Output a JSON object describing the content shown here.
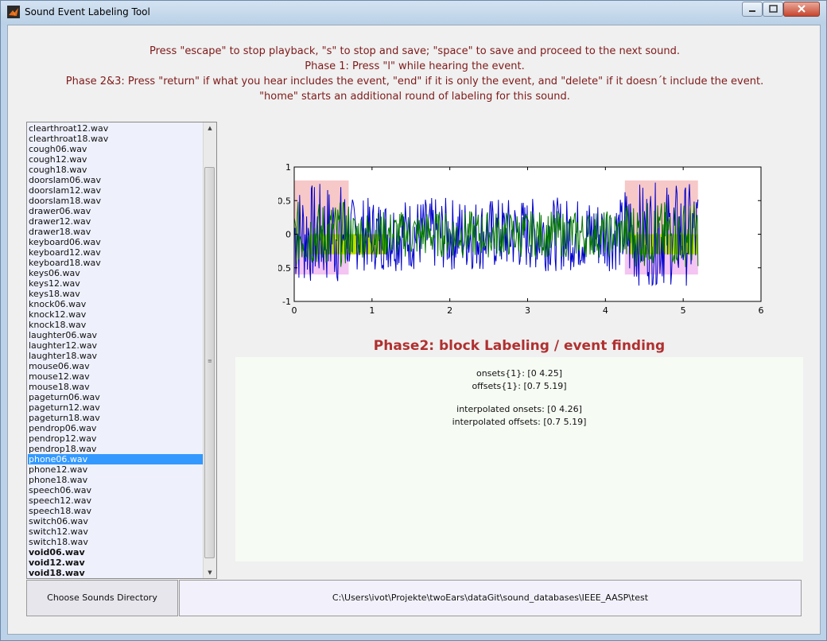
{
  "window": {
    "title": "Sound Event Labeling Tool",
    "buttons": {
      "minimize": "minimize",
      "maximize": "maximize",
      "close": "close"
    }
  },
  "instructions": [
    "Press \"escape\" to stop playback, \"s\" to stop and save; \"space\" to save and proceed to the next sound.",
    "Phase 1: Press \"l\" while hearing the event.",
    "Phase 2&3: Press \"return\" if what you hear includes the event, \"end\" if it is only the event, and \"delete\" if it doesn´t include the event.",
    "\"home\" starts an additional round of labeling for this sound."
  ],
  "file_list": {
    "items": [
      "clearthroat12.wav",
      "clearthroat18.wav",
      "cough06.wav",
      "cough12.wav",
      "cough18.wav",
      "doorslam06.wav",
      "doorslam12.wav",
      "doorslam18.wav",
      "drawer06.wav",
      "drawer12.wav",
      "drawer18.wav",
      "keyboard06.wav",
      "keyboard12.wav",
      "keyboard18.wav",
      "keys06.wav",
      "keys12.wav",
      "keys18.wav",
      "knock06.wav",
      "knock12.wav",
      "knock18.wav",
      "laughter06.wav",
      "laughter12.wav",
      "laughter18.wav",
      "mouse06.wav",
      "mouse12.wav",
      "mouse18.wav",
      "pageturn06.wav",
      "pageturn12.wav",
      "pageturn18.wav",
      "pendrop06.wav",
      "pendrop12.wav",
      "pendrop18.wav",
      "phone06.wav",
      "phone12.wav",
      "phone18.wav",
      "speech06.wav",
      "speech12.wav",
      "speech18.wav",
      "switch06.wav",
      "switch12.wav",
      "switch18.wav",
      "void06.wav",
      "void12.wav",
      "void18.wav"
    ],
    "selected": "phone06.wav",
    "bold_items": [
      "void06.wav",
      "void12.wav",
      "void18.wav"
    ],
    "scroll_up_glyph": "▲",
    "scroll_down_glyph": "▼"
  },
  "chart_data": {
    "type": "line",
    "x_ticks": [
      "0",
      "1",
      "2",
      "3",
      "4",
      "5",
      "6"
    ],
    "y_ticks": [
      "1",
      "0.5",
      "0",
      "-0.5",
      "-1"
    ],
    "xlim": [
      0,
      6
    ],
    "ylim": [
      -1,
      1
    ],
    "series": [
      {
        "color": "#0000cc",
        "description": "waveform"
      },
      {
        "color": "#007700",
        "description": "overlay waveform"
      }
    ],
    "regions": [
      {
        "x": [
          0,
          0.7
        ],
        "y": [
          0,
          0.8
        ],
        "color": "#f7c8c8"
      },
      {
        "x": [
          0,
          0.7
        ],
        "y": [
          -0.6,
          0
        ],
        "color": "#f4c4f2"
      },
      {
        "x": [
          4.25,
          5.19
        ],
        "y": [
          0,
          0.8
        ],
        "color": "#f7c8c8"
      },
      {
        "x": [
          4.25,
          5.19
        ],
        "y": [
          -0.6,
          0
        ],
        "color": "#f4c4f2"
      },
      {
        "x": [
          0.2,
          1.2
        ],
        "y": [
          -0.3,
          0
        ],
        "color": "#bfe000"
      },
      {
        "x": [
          4.3,
          5.19
        ],
        "y": [
          -0.3,
          0
        ],
        "color": "#bfe000"
      }
    ]
  },
  "phase_title": "Phase2: block Labeling / event finding",
  "info": {
    "onsets": "onsets{1}: [0 4.25]",
    "offsets": "offsets{1}: [0.7 5.19]",
    "interp_onsets": "interpolated onsets: [0 4.26]",
    "interp_offsets": "interpolated offsets: [0.7 5.19]"
  },
  "bottom": {
    "choose_button": "Choose Sounds Directory",
    "path": "C:\\Users\\ivot\\Projekte\\twoEars\\dataGit\\sound_databases\\IEEE_AASP\\test"
  }
}
